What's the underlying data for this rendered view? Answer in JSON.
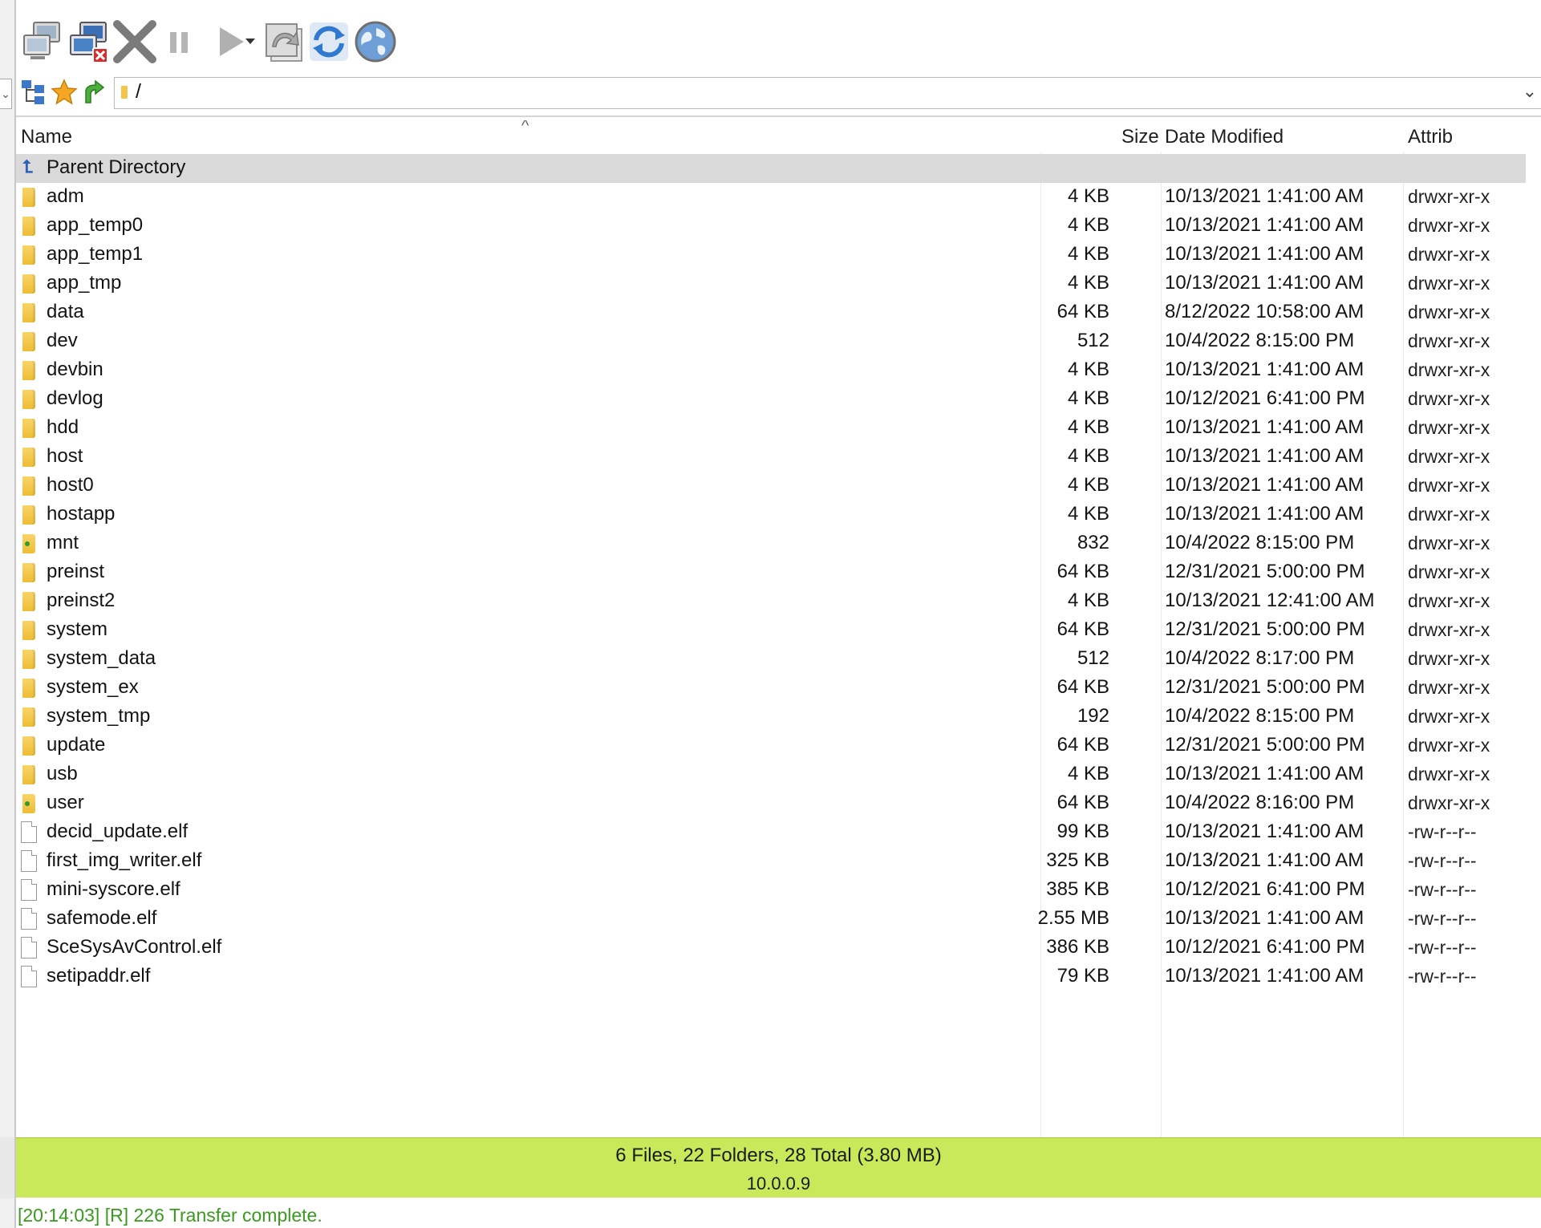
{
  "toolbar": {
    "buttons": [
      {
        "name": "connect"
      },
      {
        "name": "disconnect"
      },
      {
        "name": "abort"
      },
      {
        "name": "pause"
      },
      {
        "name": "transfer"
      },
      {
        "name": "transfer-options"
      },
      {
        "name": "queue"
      },
      {
        "name": "refresh"
      },
      {
        "name": "site-manager"
      }
    ]
  },
  "address": {
    "path": "/"
  },
  "columns": {
    "name": "Name",
    "size": "Size",
    "date": "Date Modified",
    "attrib": "Attrib"
  },
  "rows": [
    {
      "name": "Parent Directory",
      "size": "",
      "date": "",
      "attrib": "",
      "type": "parent"
    },
    {
      "name": "adm",
      "size": "4 KB",
      "date": "10/13/2021 1:41:00 AM",
      "attrib": "drwxr-xr-x",
      "type": "folder"
    },
    {
      "name": "app_temp0",
      "size": "4 KB",
      "date": "10/13/2021 1:41:00 AM",
      "attrib": "drwxr-xr-x",
      "type": "folder"
    },
    {
      "name": "app_temp1",
      "size": "4 KB",
      "date": "10/13/2021 1:41:00 AM",
      "attrib": "drwxr-xr-x",
      "type": "folder"
    },
    {
      "name": "app_tmp",
      "size": "4 KB",
      "date": "10/13/2021 1:41:00 AM",
      "attrib": "drwxr-xr-x",
      "type": "folder"
    },
    {
      "name": "data",
      "size": "64 KB",
      "date": "8/12/2022 10:58:00 AM",
      "attrib": "drwxr-xr-x",
      "type": "folder"
    },
    {
      "name": "dev",
      "size": "512",
      "date": "10/4/2022 8:15:00 PM",
      "attrib": "drwxr-xr-x",
      "type": "folder"
    },
    {
      "name": "devbin",
      "size": "4 KB",
      "date": "10/13/2021 1:41:00 AM",
      "attrib": "drwxr-xr-x",
      "type": "folder"
    },
    {
      "name": "devlog",
      "size": "4 KB",
      "date": "10/12/2021 6:41:00 PM",
      "attrib": "drwxr-xr-x",
      "type": "folder"
    },
    {
      "name": "hdd",
      "size": "4 KB",
      "date": "10/13/2021 1:41:00 AM",
      "attrib": "drwxr-xr-x",
      "type": "folder"
    },
    {
      "name": "host",
      "size": "4 KB",
      "date": "10/13/2021 1:41:00 AM",
      "attrib": "drwxr-xr-x",
      "type": "folder"
    },
    {
      "name": "host0",
      "size": "4 KB",
      "date": "10/13/2021 1:41:00 AM",
      "attrib": "drwxr-xr-x",
      "type": "folder"
    },
    {
      "name": "hostapp",
      "size": "4 KB",
      "date": "10/13/2021 1:41:00 AM",
      "attrib": "drwxr-xr-x",
      "type": "folder"
    },
    {
      "name": "mnt",
      "size": "832",
      "date": "10/4/2022 8:15:00 PM",
      "attrib": "drwxr-xr-x",
      "type": "link"
    },
    {
      "name": "preinst",
      "size": "64 KB",
      "date": "12/31/2021 5:00:00 PM",
      "attrib": "drwxr-xr-x",
      "type": "folder"
    },
    {
      "name": "preinst2",
      "size": "4 KB",
      "date": "10/13/2021 12:41:00 AM",
      "attrib": "drwxr-xr-x",
      "type": "folder"
    },
    {
      "name": "system",
      "size": "64 KB",
      "date": "12/31/2021 5:00:00 PM",
      "attrib": "drwxr-xr-x",
      "type": "folder"
    },
    {
      "name": "system_data",
      "size": "512",
      "date": "10/4/2022 8:17:00 PM",
      "attrib": "drwxr-xr-x",
      "type": "folder"
    },
    {
      "name": "system_ex",
      "size": "64 KB",
      "date": "12/31/2021 5:00:00 PM",
      "attrib": "drwxr-xr-x",
      "type": "folder"
    },
    {
      "name": "system_tmp",
      "size": "192",
      "date": "10/4/2022 8:15:00 PM",
      "attrib": "drwxr-xr-x",
      "type": "folder"
    },
    {
      "name": "update",
      "size": "64 KB",
      "date": "12/31/2021 5:00:00 PM",
      "attrib": "drwxr-xr-x",
      "type": "folder"
    },
    {
      "name": "usb",
      "size": "4 KB",
      "date": "10/13/2021 1:41:00 AM",
      "attrib": "drwxr-xr-x",
      "type": "folder"
    },
    {
      "name": "user",
      "size": "64 KB",
      "date": "10/4/2022 8:16:00 PM",
      "attrib": "drwxr-xr-x",
      "type": "link"
    },
    {
      "name": "decid_update.elf",
      "size": "99 KB",
      "date": "10/13/2021 1:41:00 AM",
      "attrib": "-rw-r--r--",
      "type": "file"
    },
    {
      "name": "first_img_writer.elf",
      "size": "325 KB",
      "date": "10/13/2021 1:41:00 AM",
      "attrib": "-rw-r--r--",
      "type": "file"
    },
    {
      "name": "mini-syscore.elf",
      "size": "385 KB",
      "date": "10/12/2021 6:41:00 PM",
      "attrib": "-rw-r--r--",
      "type": "file"
    },
    {
      "name": "safemode.elf",
      "size": "2.55 MB",
      "date": "10/13/2021 1:41:00 AM",
      "attrib": "-rw-r--r--",
      "type": "file"
    },
    {
      "name": "SceSysAvControl.elf",
      "size": "386 KB",
      "date": "10/12/2021 6:41:00 PM",
      "attrib": "-rw-r--r--",
      "type": "file"
    },
    {
      "name": "setipaddr.elf",
      "size": "79 KB",
      "date": "10/13/2021 1:41:00 AM",
      "attrib": "-rw-r--r--",
      "type": "file"
    }
  ],
  "status": {
    "summary": "6 Files, 22 Folders, 28 Total (3.80 MB)",
    "host": "10.0.0.9"
  },
  "log": {
    "last": "[20:14:03] [R] 226 Transfer complete."
  },
  "colors": {
    "status_bg": "#c7e95a",
    "log_text": "#3a9a1f",
    "folder": "#efbd35",
    "selection": "#dadada"
  }
}
